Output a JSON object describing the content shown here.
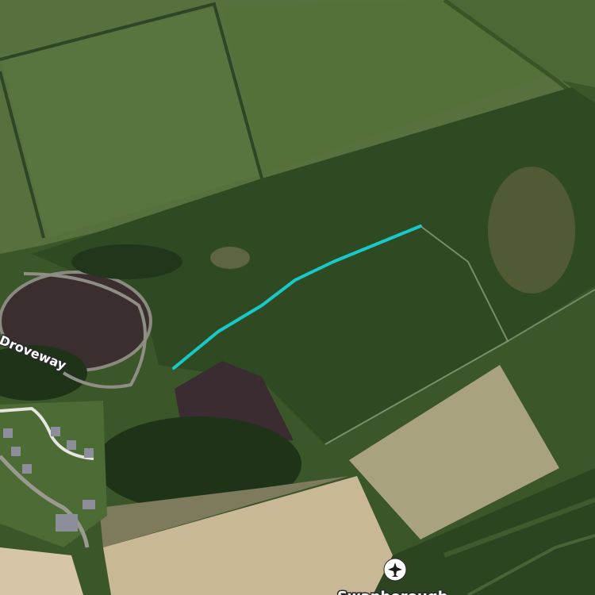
{
  "map": {
    "type": "satellite",
    "labels": {
      "road": "Droveway",
      "airfield": "Swanborough"
    },
    "icons": {
      "airfield": "airplane-icon"
    },
    "colors": {
      "route": "#19c9c9",
      "field_dark": "#2f4a22",
      "field_light": "#58703d",
      "pond": "#3a2f2e",
      "bare_field": "#c9b895",
      "tree": "#1f3319"
    }
  }
}
